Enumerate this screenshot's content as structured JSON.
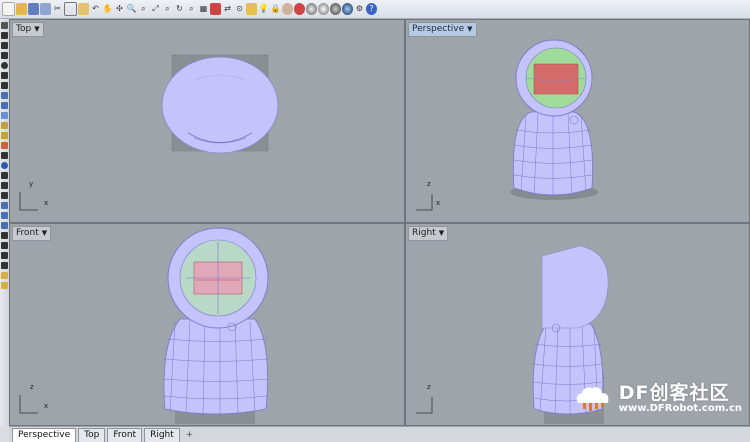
{
  "toolbar": {
    "icons": [
      "new-file",
      "open",
      "save",
      "save-as",
      "cut",
      "copy",
      "paste",
      "undo",
      "pan",
      "zoom-window",
      "zoom-extents",
      "zoom-selected",
      "rotate",
      "zoom-dynamic",
      "set-view",
      "grid-snap",
      "ortho",
      "named-cplane",
      "show-object",
      "light",
      "render-material",
      "shade",
      "rendered",
      "ghosted",
      "xray",
      "help"
    ],
    "colors": {
      "bar": "#e3e7ed"
    }
  },
  "viewports": [
    {
      "id": "top",
      "label": "Top",
      "active": false
    },
    {
      "id": "perspective",
      "label": "Perspective",
      "active": true
    },
    {
      "id": "front",
      "label": "Front",
      "active": false
    },
    {
      "id": "right",
      "label": "Right",
      "active": false
    }
  ],
  "axes": {
    "x": "x",
    "y": "y",
    "z": "z"
  },
  "tabs": {
    "t1": "Perspective",
    "t2": "Top",
    "t3": "Front",
    "t4": "Right",
    "add": "+"
  },
  "watermark": {
    "title": "DF创客社区",
    "subtitle": "www.DFRobot.com.cn"
  },
  "colors": {
    "viewport": "#9ea4a9",
    "model": "#c4c3fb",
    "wire": "#7c77cf",
    "screen_red": "#d46b6b",
    "screen_green": "#9fdc9a"
  }
}
